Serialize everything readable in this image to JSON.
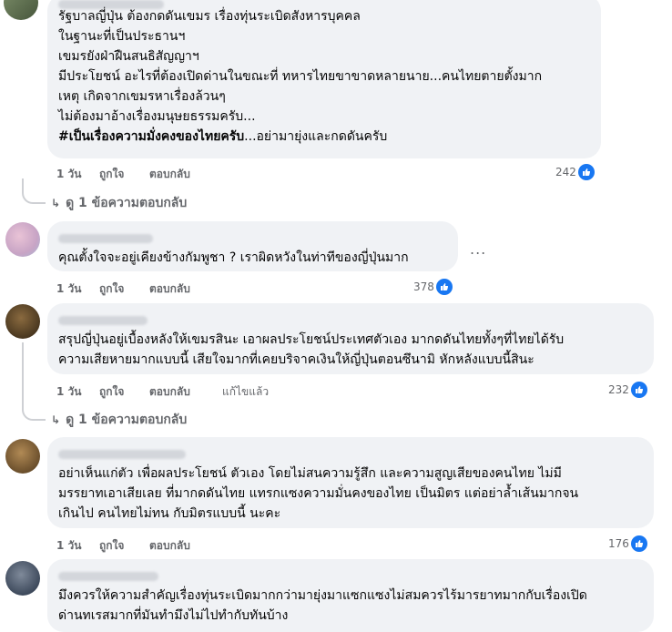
{
  "comments": [
    {
      "text_lines": [
        "รัฐบาลญี่ปุ่น ต้องกดดันเขมร เรื่องทุ่นระเบิดสังหารบุคคล",
        "ในฐานะที่เป็นประธานฯ",
        "เขมรยังฝ่าฝืนสนธิสัญญาฯ",
        "มีประโยชน์ อะไรที่ต้องเปิดด่านในขณะที่ ทหารไทยขาขาดหลายนาย...คนไทยตายตั้งมาก",
        "เหตุ เกิดจากเขมรหาเรื่องล้วนๆ",
        "ไม่ต้องมาอ้างเรื่องมนุษยธรรมครับ..."
      ],
      "hashtag": "#เป็นเรื่องความมั่งคงของไทยครับ",
      "hashtag_tail": "...อย่ามายุ่งและกดดันครับ",
      "time": "1 วัน",
      "like": "ถูกใจ",
      "reply": "ตอบกลับ",
      "reactions": "242",
      "view_replies": "ดู 1 ข้อความตอบกลับ"
    },
    {
      "text_lines": [
        "คุณตั้งใจจะอยู่เคียงข้างกัมพูชา ? เราผิดหวังในท่าทีของญี่ปุ่นมาก"
      ],
      "time": "1 วัน",
      "like": "ถูกใจ",
      "reply": "ตอบกลับ",
      "reactions": "378",
      "more": "..."
    },
    {
      "text_lines": [
        "สรุปญี่ปุ่นอยู่เบื้องหลังให้เขมรสินะ เอาผลประโยชน์ประเทศตัวเอง มากดดันไทยทั้งๆที่ไทยได้รับ",
        "ความเสียหายมากแบบนี้ เสียใจมากที่เคยบริจาคเงินให้ญี่ปุ่นตอนซึนามิ หักหลังแบบนี้สินะ"
      ],
      "time": "1 วัน",
      "like": "ถูกใจ",
      "reply": "ตอบกลับ",
      "edited": "แก้ไขแล้ว",
      "reactions": "232",
      "view_replies": "ดู 1 ข้อความตอบกลับ"
    },
    {
      "text_lines": [
        "อย่าเห็นแก่ตัว เพื่อผลประโยชน์ ตัวเอง โดยไม่สนความรู้สึก และความสูญเสียของคนไทย ไม่มี",
        "มรรยาทเอาเสียเลย ที่มากดดันไทย แทรกแซงความมั่นคงของไทย เป็นมิตร แต่อย่าล้ำเส้นมากจน",
        "เกินไป คนไทยไม่ทน กับมิตรแบบนี้ นะคะ"
      ],
      "time": "1 วัน",
      "like": "ถูกใจ",
      "reply": "ตอบกลับ",
      "reactions": "176"
    },
    {
      "text_lines": [
        "มึงควรให้ความสำคัญเรื่องทุ่นระเบิดมากกว่ามายุ่งมาแซกแซงไม่สมควรไร้มารยาทมากกับเรื่องเปิด",
        "ด่านทเรสมากที่มันทำมึงไม่ไปทำกับทันบ้าง"
      ]
    }
  ],
  "colors": {
    "bubble": "#f0f2f5",
    "meta_text": "#65676b",
    "like_blue": "#1877f2"
  }
}
